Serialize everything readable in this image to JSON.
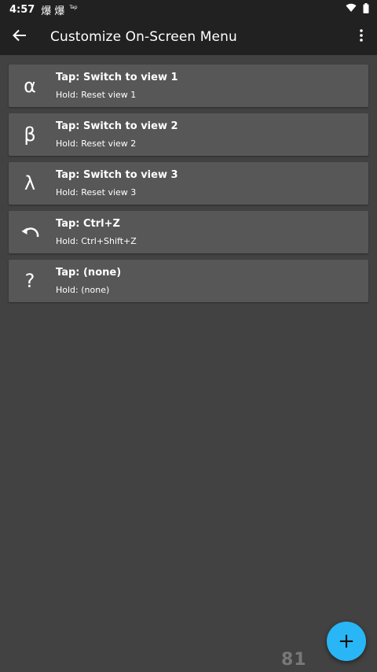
{
  "status_bar": {
    "time": "4:57",
    "glyph_1": "爆",
    "glyph_2": "爆",
    "tap_label": "Tap"
  },
  "app_bar": {
    "title": "Customize On-Screen Menu"
  },
  "items": [
    {
      "icon": "α",
      "tap": "Tap: Switch to view 1",
      "hold": "Hold: Reset view 1"
    },
    {
      "icon": "β",
      "tap": "Tap: Switch to view 2",
      "hold": "Hold: Reset view 2"
    },
    {
      "icon": "λ",
      "tap": "Tap: Switch to view 3",
      "hold": "Hold: Reset view 3"
    },
    {
      "icon": "undo-icon",
      "tap": "Tap: Ctrl+Z",
      "hold": "Hold: Ctrl+Shift+Z"
    },
    {
      "icon": "?",
      "tap": "Tap: (none)",
      "hold": "Hold: (none)"
    }
  ],
  "fab": {
    "label": "+"
  },
  "watermark": "81",
  "colors": {
    "background": "#424242",
    "bar": "#212121",
    "item": "#575757",
    "fab": "#29b6f6"
  }
}
